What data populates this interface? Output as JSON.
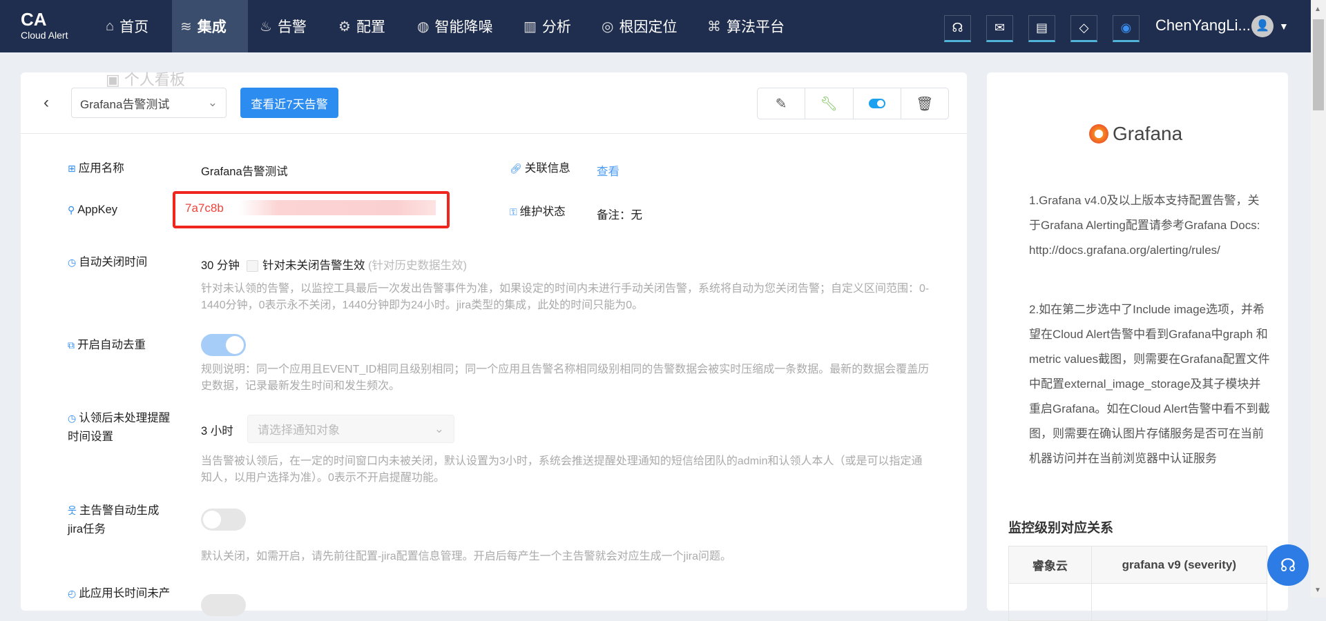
{
  "nav": {
    "logo": "CA",
    "logo_sub": "Cloud Alert",
    "items": [
      {
        "label": "首页",
        "icon": "home-icon"
      },
      {
        "label": "集成",
        "icon": "layers-icon"
      },
      {
        "label": "告警",
        "icon": "alarm-light-icon"
      },
      {
        "label": "配置",
        "icon": "gear-icon"
      },
      {
        "label": "智能降噪",
        "icon": "sound-wave-icon"
      },
      {
        "label": "分析",
        "icon": "bar-chart-icon"
      },
      {
        "label": "根因定位",
        "icon": "target-icon"
      },
      {
        "label": "算法平台",
        "icon": "algorithm-icon"
      }
    ],
    "user": "ChenYangLi...",
    "ghost_menu": "个人看板"
  },
  "header": {
    "select_value": "Grafana告警测试",
    "view_button": "查看近7天告警"
  },
  "fields": {
    "app_name_label": "应用名称",
    "app_name": "Grafana告警测试",
    "related_label": "关联信息",
    "related_link": "查看",
    "appkey_label": "AppKey",
    "appkey": "7a7c8b",
    "maint_label": "维护状态",
    "maint_value": "备注：无",
    "autoclose_label": "自动关闭时间",
    "autoclose_value": "30 分钟",
    "autoclose_checkbox": "针对未关闭告警生效",
    "autoclose_hint": "(针对历史数据生效)",
    "autoclose_desc": "针对未认领的告警，以监控工具最后一次发出告警事件为准，如果设定的时间内未进行手动关闭告警，系统将自动为您关闭告警；自定义区间范围：0-1440分钟，0表示永不关闭，1440分钟即为24小时。jira类型的集成，此处的时间只能为0。",
    "dedup_label": "开启自动去重",
    "dedup_on": true,
    "dedup_desc": "规则说明：同一个应用且EVENT_ID相同且级别相同；同一个应用且告警名称相同级别相同的告警数据会被实时压缩成一条数据。最新的数据会覆盖历史数据，记录最新发生时间和发生频次。",
    "remind_label": "认领后未处理提醒时间设置",
    "remind_value": "3 小时",
    "remind_placeholder": "请选择通知对象",
    "remind_desc": "当告警被认领后，在一定的时间窗口内未被关闭，默认设置为3小时，系统会推送提醒处理通知的短信给团队的admin和认领人本人（或是可以指定通知人，以用户选择为准）。0表示不开启提醒功能。",
    "jira_label": "主告警自动生成jira任务",
    "jira_on": false,
    "jira_desc": "默认关闭，如需开启，请先前往配置-jira配置信息管理。开启后每产生一个主告警就会对应生成一个jira问题。",
    "idle_label": "此应用长时间未产"
  },
  "side": {
    "logo": "Grafana",
    "p1": "1.Grafana v4.0及以上版本支持配置告警，关于Grafana Alerting配置请参考Grafana Docs: http://docs.grafana.org/alerting/rules/",
    "p2": "2.如在第二步选中了Include image选项，并希望在Cloud Alert告警中看到Grafana中graph 和metric values截图，则需要在Grafana配置文件中配置external_image_storage及其子模块并重启Grafana。如在Cloud Alert告警中看不到截图，则需要在确认图片存储服务是否可在当前机器访问并在当前浏览器中认证服务",
    "heading": "监控级别对应关系",
    "col1": "睿象云",
    "col2": "grafana v9 (severity)"
  },
  "colors": {
    "nav": "#1f2d4e",
    "primary": "#2d8cf0",
    "appkey": "#f0413a"
  }
}
